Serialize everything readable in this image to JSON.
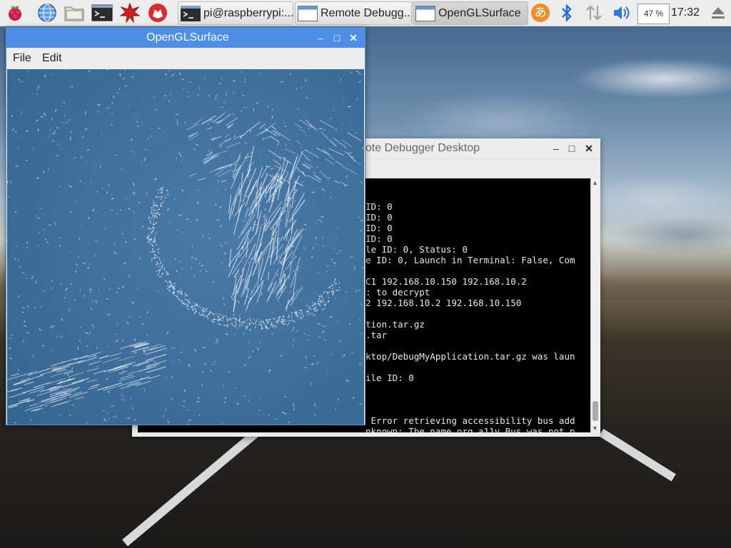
{
  "taskbar": {
    "tasks": [
      {
        "label": "pi@raspberrypi:..."
      },
      {
        "label": "Remote Debugg..."
      },
      {
        "label": "OpenGLSurface"
      }
    ],
    "cpu": "47 %",
    "clock": "17:32",
    "ime_glyph": "あ"
  },
  "debugger": {
    "title": "Remote Debugger Desktop",
    "visible_title": "note Debugger Desktop",
    "lines": [
      "ID: 0",
      "ID: 0",
      "ID: 0",
      "ID: 0",
      "le ID: 0, Status: 0",
      "e ID: 0, Launch in Terminal: False, Com",
      "",
      "C1 192.168.10.150 192.168.10.2",
      ": to decrypt",
      "2 192.168.10.2 192.168.10.150",
      "",
      "tion.tar.gz",
      ".tar",
      "",
      "ktop/DebugMyApplication.tar.gz was laun",
      "",
      "ile ID: 0",
      "",
      "",
      "",
      " Error retrieving accessibility bus add",
      "nknown: The name org.a11y.Bus was not p"
    ]
  },
  "gl": {
    "title": "OpenGLSurface",
    "menu": [
      "File",
      "Edit"
    ]
  },
  "colors": {
    "gl_titlebar": "#4d8fe6",
    "gl_background": "#3d6d98",
    "terminal_bg": "#000000"
  },
  "icons": [
    "raspberry-menu-icon",
    "web-browser-icon",
    "file-manager-icon",
    "terminal-icon",
    "mathematica-icon",
    "wolfram-icon",
    "ime-icon",
    "bluetooth-icon",
    "network-icon",
    "volume-icon",
    "eject-icon"
  ]
}
